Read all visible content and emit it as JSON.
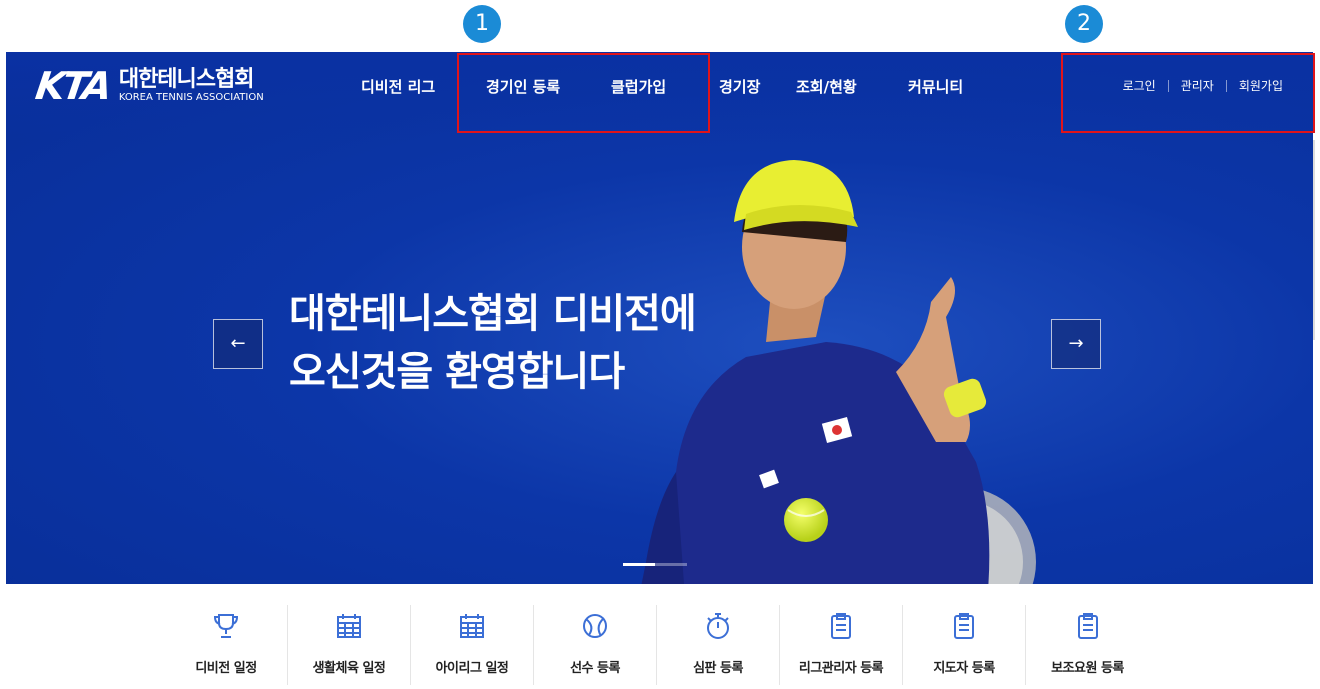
{
  "callouts": [
    "1",
    "2"
  ],
  "header": {
    "logo_mark": "KTA",
    "logo_korean": "대한테니스협회",
    "logo_english": "KOREA TENNIS ASSOCIATION",
    "nav": [
      "디비전 리그",
      "경기인 등록",
      "클럽가입",
      "경기장",
      "조회/현황",
      "커뮤니티"
    ],
    "util": [
      "로그인",
      "관리자",
      "회원가입"
    ]
  },
  "hero": {
    "title_line1": "대한테니스협회 디비전에",
    "title_line2": "오신것을 환영합니다",
    "prev_arrow": "←",
    "next_arrow": "→",
    "slide_count": 2,
    "active_slide": 1
  },
  "quick_menu": [
    {
      "label": "디비전 일정",
      "icon": "trophy-icon"
    },
    {
      "label": "생활체육 일정",
      "icon": "calendar-icon"
    },
    {
      "label": "아이리그 일정",
      "icon": "calendar-icon"
    },
    {
      "label": "선수 등록",
      "icon": "tennis-ball-icon"
    },
    {
      "label": "심판 등록",
      "icon": "stopwatch-icon"
    },
    {
      "label": "리그관리자 등록",
      "icon": "clipboard-icon"
    },
    {
      "label": "지도자 등록",
      "icon": "clipboard-icon"
    },
    {
      "label": "보조요원 등록",
      "icon": "clipboard-icon"
    }
  ],
  "colors": {
    "hero_blue": "#0c36a8",
    "badge_blue": "#1b8bd6",
    "highlight_red": "#e0141a",
    "icon_blue": "#3c6fd6"
  }
}
